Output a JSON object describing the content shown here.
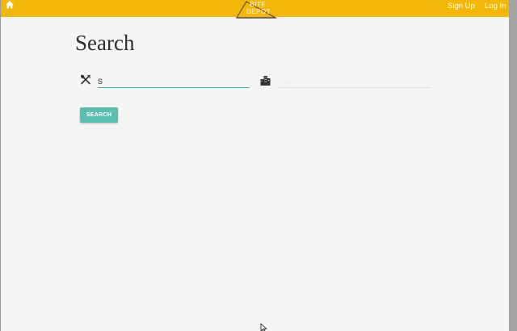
{
  "navbar": {
    "brand_line1": "BITE",
    "brand_line2": "DEPOT",
    "signup_label": "Sign Up",
    "login_label": "Log In",
    "icon": "home-icon",
    "bg_color": "#f2b707"
  },
  "main": {
    "title": "Search",
    "food_input": {
      "value": "S",
      "icon": "fork-knife-icon"
    },
    "city_input": {
      "placeholder": "City",
      "icon": "city-icon"
    },
    "search_button_label": "SEARCH",
    "accent_color": "#5bbfb0"
  }
}
